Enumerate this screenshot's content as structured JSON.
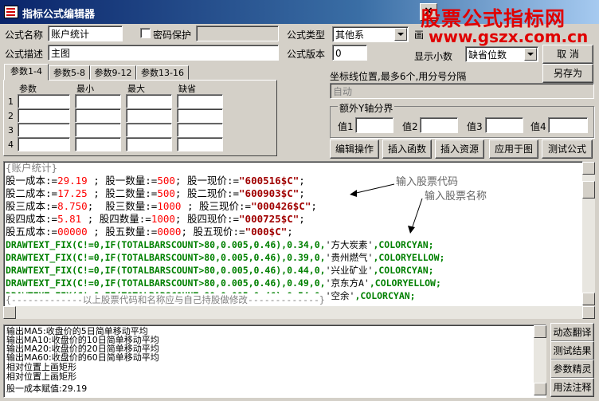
{
  "window": {
    "title": "指标公式编辑器",
    "close_label": "×"
  },
  "watermark": {
    "line1": "股票公式指标网",
    "line2": "www.gszx.com.cn"
  },
  "form": {
    "name_label": "公式名称",
    "name_value": "账户统计",
    "password_label": "密码保护",
    "type_label": "公式类型",
    "type_value": "其他系",
    "desc_label": "公式描述",
    "desc_value": "主图",
    "version_label": "公式版本",
    "version_value": "0",
    "decimals_label": "显示小数",
    "decimals_value": "缺省位数",
    "cancel_button": "取  消",
    "saveas_button": "另存为"
  },
  "param_tabs": [
    "参数1-4",
    "参数5-8",
    "参数9-12",
    "参数13-16"
  ],
  "param_headers": [
    "参数",
    "最小",
    "最大",
    "缺省"
  ],
  "param_rows": [
    "1",
    "2",
    "3",
    "4"
  ],
  "axis": {
    "label": "坐标线位置,最多6个,用分号分隔",
    "value": "自动",
    "group_label": "额外Y轴分界",
    "values": [
      "值1",
      "值2",
      "值3",
      "值4"
    ]
  },
  "buttons": {
    "edit": "编辑操作",
    "insert_func": "插入函数",
    "insert_res": "插入资源",
    "apply": "应用于图",
    "test": "测试公式",
    "dyn_translate": "动态翻译",
    "test_result": "测试结果",
    "param_tune": "参数精灵",
    "usage_note": "用法注释"
  },
  "annotations": {
    "code": "输入股票代码",
    "name": "输入股票名称"
  },
  "code": {
    "comment_top": "{账户统计}",
    "l1": {
      "a": "股一成本:=",
      "b": "29.19",
      "c": " ; 股一数量:=",
      "d": "500",
      "e": "; 股一现价:=",
      "f": "\"600516$C\"",
      "g": ";"
    },
    "l2": {
      "a": "股二成本:=",
      "b": "17.25",
      "c": " ; 股二数量:=",
      "d": "500",
      "e": "; 股二现价:=",
      "f": "\"600903$C\"",
      "g": ";"
    },
    "l3": {
      "a": "股三成本:=",
      "b": "8.750",
      "c": ";  股三数量:=",
      "d": "1000",
      "e": " ; 股三现价:=",
      "f": "\"000426$C\"",
      "g": ";"
    },
    "l4": {
      "a": "股四成本:=",
      "b": "5.81",
      "c": " ; 股四数量:=",
      "d": "1000",
      "e": "; 股四现价:=",
      "f": "\"000725$C\"",
      "g": ";"
    },
    "l5": {
      "a": "股五成本:=",
      "b": "00000",
      "c": " ; 股五数量:=",
      "d": "0000",
      "e": "; 股五现价:=",
      "f": "\"000$C\"",
      "g": ";"
    },
    "draw": [
      {
        "pre": "DRAWTEXT_FIX(C!=0,IF(TOTALBARSCOUNT>80,0.005,0.46),0.34,0,",
        "txt": "'方大炭素'",
        "post": ",COLORCYAN;"
      },
      {
        "pre": "DRAWTEXT_FIX(C!=0,IF(TOTALBARSCOUNT>80,0.005,0.46),0.39,0,",
        "txt": "'贵州燃气'",
        "post": ",COLORYELLOW;"
      },
      {
        "pre": "DRAWTEXT_FIX(C!=0,IF(TOTALBARSCOUNT>80,0.005,0.46),0.44,0,",
        "txt": "'兴业矿业'",
        "post": ",COLORCYAN;"
      },
      {
        "pre": "DRAWTEXT_FIX(C!=0,IF(TOTALBARSCOUNT>80,0.005,0.46),0.49,0,",
        "txt": "'京东方A'",
        "post": ",COLORYELLOW;"
      },
      {
        "pre": "DRAWTEXT_FIX(C!=0,IF(TOTALBARSCOUNT>80,0.005,0.46),0.54,0,",
        "txt": "'空余'",
        "post": ",COLORCYAN;"
      }
    ],
    "comment_bottom": "{-------------以上股票代码和名称应与自己持股做修改-------------}"
  },
  "output": [
    "输出MA5:收盘价的5日简单移动平均",
    "输出MA10:收盘价的10日简单移动平均",
    "输出MA20:收盘价的20日简单移动平均",
    "输出MA60:收盘价的60日简单移动平均",
    "相对位置上画矩形",
    "相对位置上画矩形",
    "股一成本赋值:29.19"
  ]
}
